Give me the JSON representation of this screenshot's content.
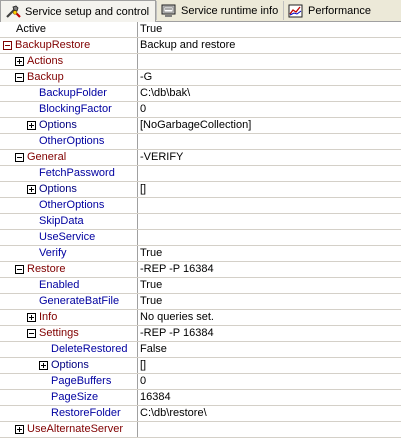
{
  "tabs": [
    {
      "label": "Service setup and control",
      "icon": "tools-icon",
      "active": true
    },
    {
      "label": "Service runtime info",
      "icon": "monitor-icon",
      "active": false
    },
    {
      "label": "Performance",
      "icon": "chart-icon",
      "active": false
    }
  ],
  "rows": [
    {
      "name": "Active",
      "value": "True",
      "level": 0,
      "exp": "none",
      "kind": "first"
    },
    {
      "name": "BackupRestore",
      "value": "Backup and restore",
      "level": 0,
      "exp": "minus",
      "kind": "cat"
    },
    {
      "name": "Actions",
      "value": "",
      "level": 1,
      "exp": "plus",
      "kind": "cat"
    },
    {
      "name": "Backup",
      "value": "-G",
      "level": 1,
      "exp": "minus",
      "kind": "cat"
    },
    {
      "name": "BackupFolder",
      "value": "C:\\db\\bak\\",
      "level": 2,
      "exp": "none",
      "kind": "leaf"
    },
    {
      "name": "BlockingFactor",
      "value": "0",
      "level": 2,
      "exp": "none",
      "kind": "leaf"
    },
    {
      "name": "Options",
      "value": "[NoGarbageCollection]",
      "level": 2,
      "exp": "plus",
      "kind": "sub"
    },
    {
      "name": "OtherOptions",
      "value": "",
      "level": 2,
      "exp": "none",
      "kind": "leaf"
    },
    {
      "name": "General",
      "value": "-VERIFY",
      "level": 1,
      "exp": "minus",
      "kind": "cat"
    },
    {
      "name": "FetchPassword",
      "value": "",
      "level": 2,
      "exp": "none",
      "kind": "leaf"
    },
    {
      "name": "Options",
      "value": "[]",
      "level": 2,
      "exp": "plus",
      "kind": "sub"
    },
    {
      "name": "OtherOptions",
      "value": "",
      "level": 2,
      "exp": "none",
      "kind": "leaf"
    },
    {
      "name": "SkipData",
      "value": "",
      "level": 2,
      "exp": "none",
      "kind": "leaf"
    },
    {
      "name": "UseService",
      "value": "",
      "level": 2,
      "exp": "none",
      "kind": "leaf"
    },
    {
      "name": "Verify",
      "value": "True",
      "level": 2,
      "exp": "none",
      "kind": "leaf"
    },
    {
      "name": "Restore",
      "value": "-REP -P 16384",
      "level": 1,
      "exp": "minus",
      "kind": "cat"
    },
    {
      "name": "Enabled",
      "value": "True",
      "level": 2,
      "exp": "none",
      "kind": "leaf"
    },
    {
      "name": "GenerateBatFile",
      "value": "True",
      "level": 2,
      "exp": "none",
      "kind": "leaf"
    },
    {
      "name": "Info",
      "value": "No queries set.",
      "level": 2,
      "exp": "plus",
      "kind": "cat"
    },
    {
      "name": "Settings",
      "value": "-REP -P 16384",
      "level": 2,
      "exp": "minus",
      "kind": "cat"
    },
    {
      "name": "DeleteRestored",
      "value": "False",
      "level": 3,
      "exp": "none",
      "kind": "leaf"
    },
    {
      "name": "Options",
      "value": "[]",
      "level": 3,
      "exp": "plus",
      "kind": "sub"
    },
    {
      "name": "PageBuffers",
      "value": "0",
      "level": 3,
      "exp": "none",
      "kind": "leaf"
    },
    {
      "name": "PageSize",
      "value": "16384",
      "level": 3,
      "exp": "none",
      "kind": "leaf"
    },
    {
      "name": "RestoreFolder",
      "value": "C:\\db\\restore\\",
      "level": 3,
      "exp": "none",
      "kind": "leaf"
    },
    {
      "name": "UseAlternateServer",
      "value": "",
      "level": 1,
      "exp": "plus",
      "kind": "cat"
    }
  ]
}
